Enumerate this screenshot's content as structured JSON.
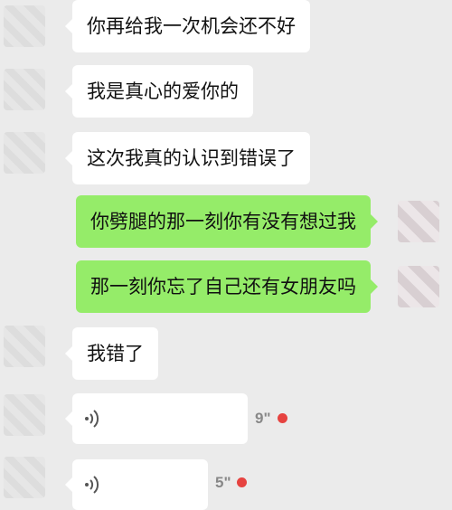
{
  "messages": [
    {
      "side": "in",
      "text": "你再给我一次机会还不好"
    },
    {
      "side": "in",
      "text": "我是真心的爱你的"
    },
    {
      "side": "in",
      "text": "这次我真的认识到错误了"
    },
    {
      "side": "out",
      "text": "你劈腿的那一刻你有没有想过我"
    },
    {
      "side": "out",
      "text": "那一刻你忘了自己还有女朋友吗"
    },
    {
      "side": "in",
      "text": "我错了"
    }
  ],
  "voice_messages": [
    {
      "duration": "9\"",
      "unread": true
    },
    {
      "duration": "5\"",
      "unread": true
    }
  ],
  "icons": {
    "voice": "voice-wave-icon",
    "unread": "unread-dot"
  },
  "colors": {
    "background": "#ebebeb",
    "incoming_bubble": "#ffffff",
    "outgoing_bubble": "#95ec69",
    "unread_dot": "#e64340"
  }
}
